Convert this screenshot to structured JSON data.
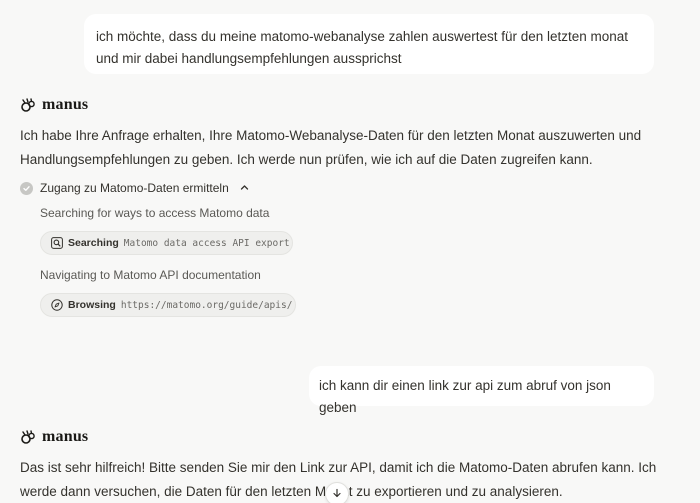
{
  "conversation": {
    "user_message_1": "ich möchte, dass du meine matomo-webanalyse zahlen auswertest für den letzten monat und mir dabei handlungsempfehlungen aussprichst",
    "agent_name": "manus",
    "agent_message_1": "Ich habe Ihre Anfrage erhalten, Ihre Matomo-Webanalyse-Daten für den letzten Monat auszuwerten und Handlungsempfehlungen zu geben. Ich werde nun prüfen, wie ich auf die Daten zugreifen kann.",
    "step": {
      "title": "Zugang zu Matomo-Daten ermitteln",
      "substeps": [
        {
          "label": "Searching for ways to access Matomo data",
          "action": "Searching",
          "argument": "Matomo data access API export",
          "icon": "search-icon"
        },
        {
          "label": "Navigating to Matomo API documentation",
          "action": "Browsing",
          "argument": "https://matomo.org/guide/apis/",
          "icon": "compass-icon"
        }
      ]
    },
    "user_message_2": "ich kann dir einen link zur api zum abruf von json geben",
    "agent_message_2": "Das ist sehr hilfreich! Bitte senden Sie mir den Link zur API, damit ich die Matomo-Daten abrufen kann. Ich werde dann versuchen, die Daten für den letzten Monat zu exportieren und zu analysieren."
  },
  "icons": {
    "agent_logo": "manus-logo-icon",
    "step_status": "check-circle-icon",
    "collapse": "chevron-up-icon",
    "scroll": "arrow-down-icon"
  },
  "colors": {
    "background": "#f8f8f7",
    "bubble": "#ffffff",
    "text": "#34322d"
  }
}
